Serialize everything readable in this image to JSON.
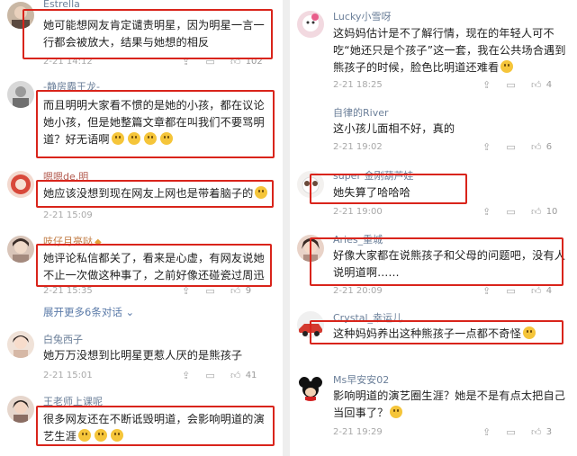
{
  "left": {
    "comments": [
      {
        "name": "Estrella",
        "text": "她可能想网友肯定谴责明星，因为明星一言一行都会被放大，结果与她想的相反",
        "time": "2-21 14:12",
        "likes": "102"
      },
      {
        "name": "-静房霸王龙-",
        "text": "而且明明大家看不惯的是她的小孩，都在议论她小孩，但是她整篇文章都在叫我们不要骂明道？好无语啊",
        "time": "",
        "likes": ""
      },
      {
        "name": "嗯嗯de.明",
        "text": "她应该没想到现在网友上网也是带着脑子的",
        "time": "2-21 15:09",
        "likes": ""
      },
      {
        "name": "吱仔月亮哒",
        "text": "她评论私信都关了，看来是心虚，有网友说她不止一次做这种事了，之前好像还碰瓷过周迅",
        "time": "2-21 15:35",
        "likes": "9"
      },
      {
        "name": "白兔西子",
        "text": "她万万没想到比明星更惹人厌的是熊孩子",
        "time": "2-21 15:01",
        "likes": "41"
      },
      {
        "name": "王老师上课呢",
        "text": "很多网友还在不断诋毁明道，会影响明道的演艺生涯",
        "time": "",
        "likes": ""
      }
    ],
    "expand_label": "展开更多6条对话",
    "expand_icon": "chevron-down"
  },
  "right": {
    "comments": [
      {
        "name": "Lucky小雪呀",
        "text": "这妈妈估计是不了解行情，现在的年轻人可不吃“她还只是个孩子”这一套，我在公共场合遇到熊孩子的时候，脸色比明道还难看",
        "time": "2-21 18:25",
        "likes": "4"
      },
      {
        "name": "自律的River",
        "text": "这小孩儿面相不好，真的",
        "time": "2-21 19:02",
        "likes": "6"
      },
      {
        "name": "super 金刚葫芦娃",
        "text": "她失算了哈哈哈",
        "time": "2-21 19:00",
        "likes": "10"
      },
      {
        "name": "Aries_重城",
        "text": "好像大家都在说熊孩子和父母的问题吧，没有人说明道啊……",
        "time": "2-21 20:09",
        "likes": "4"
      },
      {
        "name": "Crystal_幸运儿",
        "text": "这种妈妈养出这种熊孩子一点都不奇怪",
        "time": "",
        "likes": ""
      },
      {
        "name": "Ms早安安02",
        "text": "影响明道的演艺圈生涯？她是不是有点太把自己当回事了？",
        "time": "2-21 19:29",
        "likes": "3"
      }
    ]
  },
  "colors": {
    "highlight_box": "#d9241b",
    "username": "#6b7f99",
    "expand_link": "#5a7aa8",
    "meta": "#a8a8a8"
  }
}
